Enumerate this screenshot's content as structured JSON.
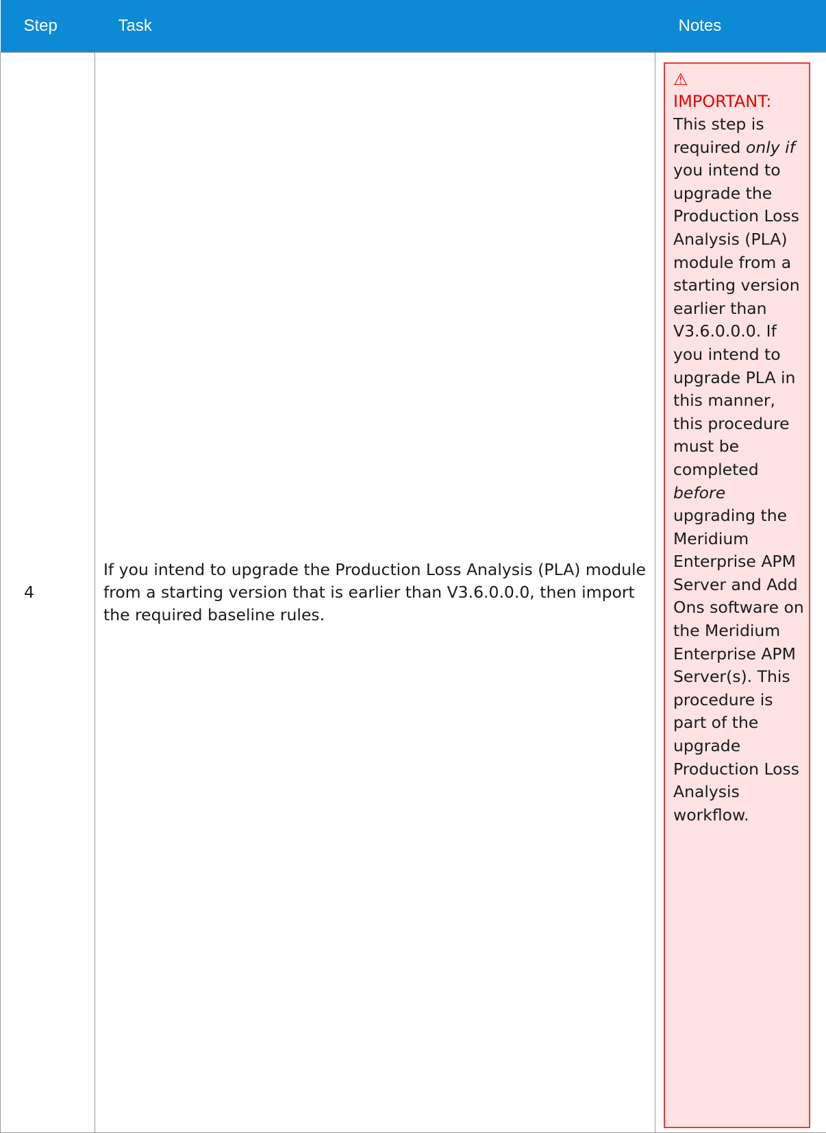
{
  "table": {
    "headers": {
      "step": "Step",
      "task": "Task",
      "notes": "Notes"
    },
    "row": {
      "step": "4",
      "task": "If you intend to upgrade the Production Loss Analysis (PLA) module from a starting version that is earlier than V3.6.0.0.0, then import the required baseline rules.",
      "note": {
        "icon": "warning-triangle-icon",
        "label": "IMPORTANT:",
        "text_1": "This step is required ",
        "em_1": "only if",
        "text_2": " you intend to upgrade the Production Loss Analysis (PLA) module from a starting version earlier than V3.6.0.0.0. If you intend to upgrade PLA in this manner, this procedure must be completed ",
        "em_2": "before",
        "text_3": " upgrading the Meridium Enterprise APM Server and Add Ons software on the Meridium Enterprise APM Server(s). This procedure is part of the upgrade Production Loss Analysis workflow."
      }
    }
  },
  "colors": {
    "header_bg": "#0c8ad6",
    "important_bg": "#ffe3e3",
    "important_border": "#e63a3a",
    "important_text": "#e60000"
  }
}
